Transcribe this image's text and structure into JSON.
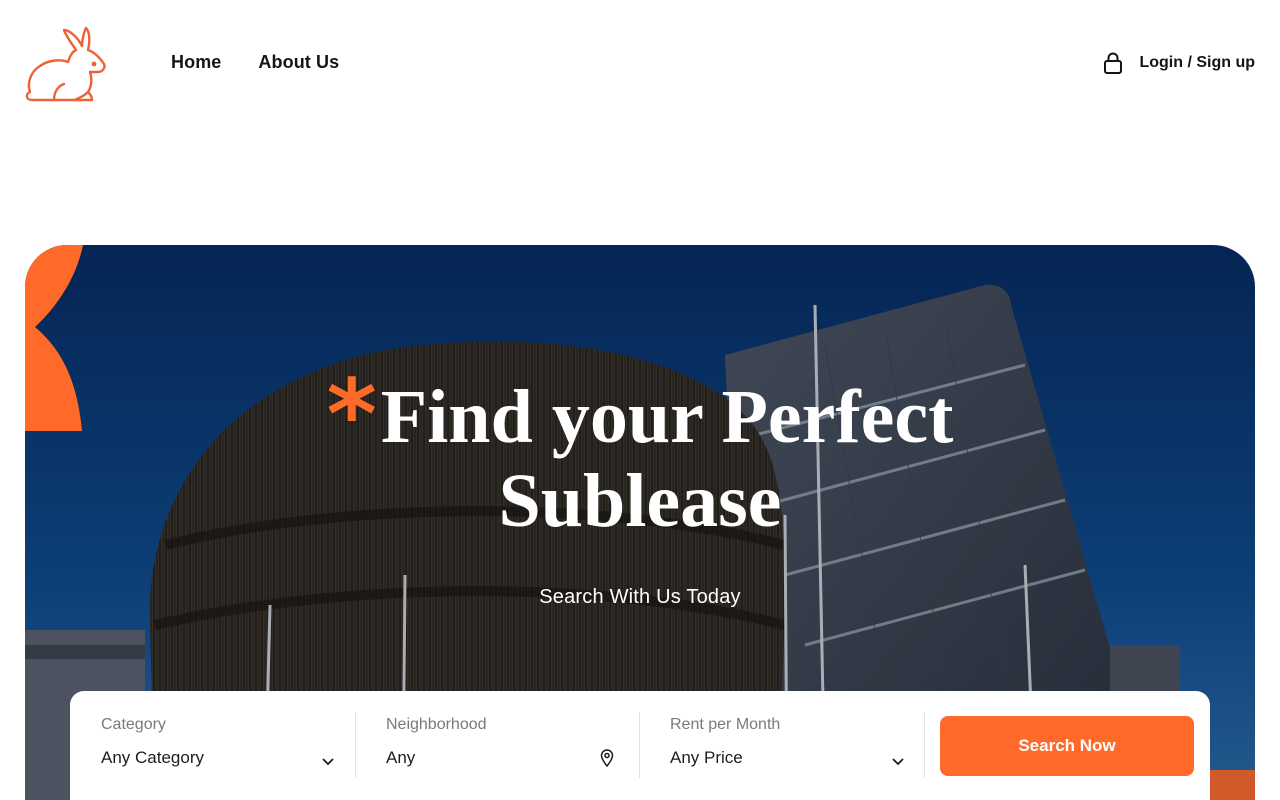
{
  "nav": {
    "links": [
      "Home",
      "About Us"
    ],
    "login_label": "Login / Sign up"
  },
  "hero": {
    "title_line1": "Find your Perfect",
    "title_line2": "Sublease",
    "star": "*",
    "subtitle": "Search With Us Today"
  },
  "search": {
    "category": {
      "label": "Category",
      "value": "Any Category"
    },
    "neighborhood": {
      "label": "Neighborhood",
      "value": "Any"
    },
    "rent": {
      "label": "Rent per Month",
      "value": "Any Price"
    },
    "button_label": "Search Now"
  },
  "colors": {
    "accent": "#ff6a2a",
    "sky": "#0a3d7a",
    "text": "#151515"
  },
  "icons": [
    "rabbit-logo-icon",
    "lock-icon",
    "chevron-down-icon",
    "map-pin-icon"
  ]
}
